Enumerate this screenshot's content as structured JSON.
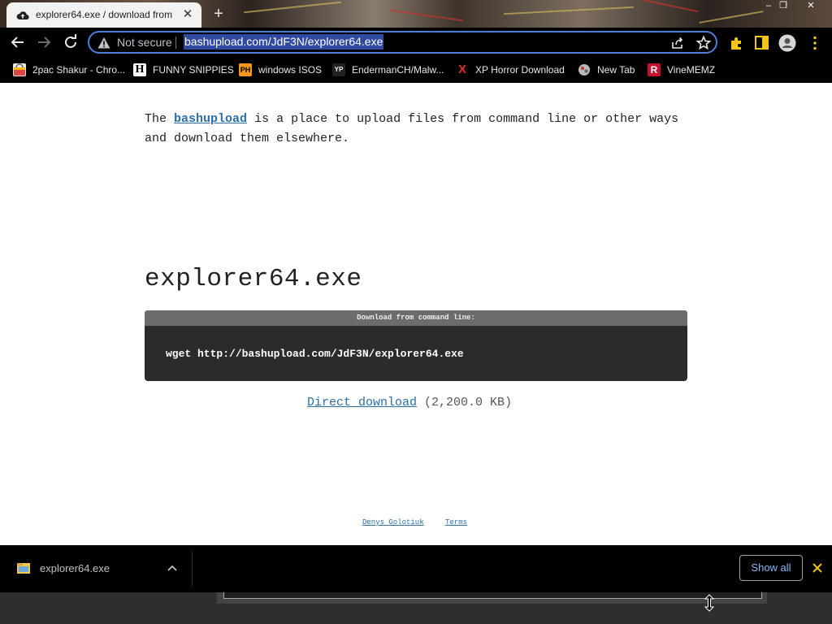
{
  "tab": {
    "title": "explorer64.exe / download from",
    "icon": "cloud-upload-icon"
  },
  "toolbar": {
    "security_label": "Not secure",
    "url": "bashupload.com/JdF3N/explorer64.exe"
  },
  "bookmarks": [
    {
      "label": "2pac Shakur - Chro...",
      "icon": "chrome-store-icon"
    },
    {
      "label": "FUNNY SNIPPIES",
      "icon": "H"
    },
    {
      "label": "windows ISOS",
      "icon": "PH"
    },
    {
      "label": "EndermanCH/Malw...",
      "icon": "YP"
    },
    {
      "label": "XP Horror Download",
      "icon": "X"
    },
    {
      "label": "New Tab",
      "icon": "globe-icon"
    },
    {
      "label": "VineMEMZ",
      "icon": "R"
    }
  ],
  "page": {
    "intro_prefix": "The",
    "intro_link": "bashupload",
    "intro_suffix": "is a place to upload files from command line or other ways and download them elsewhere.",
    "filename": "explorer64.exe",
    "cmd_header": "Download from command line:",
    "cmd": "wget http://bashupload.com/JdF3N/explorer64.exe",
    "direct_download": "Direct download",
    "size": "(2,200.0 KB)",
    "footer_author": "Denys Golotiuk",
    "footer_terms": "Terms"
  },
  "download_shelf": {
    "filename": "explorer64.exe",
    "show_all": "Show all"
  },
  "colors": {
    "link": "#2a6fa8",
    "omnibox_border": "#4e7fd8",
    "url_selection": "#2f4aa0",
    "cmd_bg": "#2b2b2b"
  }
}
